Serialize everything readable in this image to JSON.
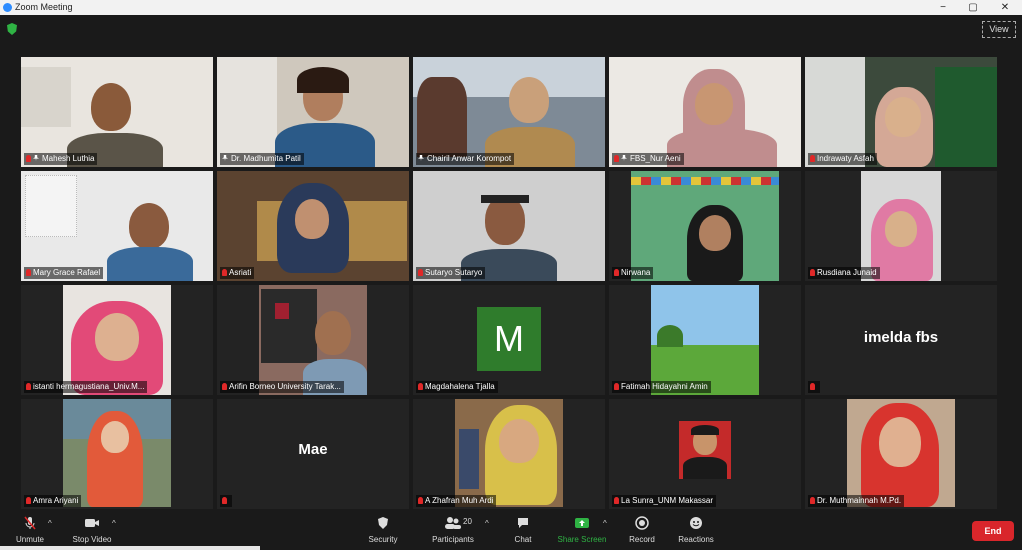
{
  "window": {
    "title": "Zoom Meeting",
    "minimize": "−",
    "maximize": "▢",
    "close": "✕"
  },
  "top": {
    "view_label": "View"
  },
  "participants": [
    {
      "name": "Mahesh Luthia",
      "pinned": true,
      "muted": true
    },
    {
      "name": "Dr. Madhumita Patil",
      "pinned": true,
      "muted": false,
      "active": true
    },
    {
      "name": "Chairil Anwar Korompot",
      "pinned": true,
      "muted": false
    },
    {
      "name": "FBS_Nur Aeni",
      "pinned": true,
      "muted": true
    },
    {
      "name": "Indrawaty Asfah",
      "pinned": false,
      "muted": true
    },
    {
      "name": "Mary Grace Rafael",
      "pinned": false,
      "muted": true
    },
    {
      "name": "Asriati",
      "pinned": false,
      "muted": true
    },
    {
      "name": "Sutaryo Sutaryo",
      "pinned": false,
      "muted": true
    },
    {
      "name": "Nirwana",
      "pinned": false,
      "muted": true
    },
    {
      "name": "Rusdiana Junaid",
      "pinned": false,
      "muted": true
    },
    {
      "name": "istanti hermagustiana_Univ.M...",
      "pinned": false,
      "muted": true
    },
    {
      "name": "Arifin Borneo University Tarak...",
      "pinned": false,
      "muted": true
    },
    {
      "name": "Magdahalena Tjalla",
      "pinned": false,
      "muted": true
    },
    {
      "name": "Fatimah Hidayahni Amin",
      "pinned": false,
      "muted": true
    },
    {
      "name": "",
      "pinned": false,
      "muted": true
    },
    {
      "name": "Amra Ariyani",
      "pinned": false,
      "muted": true
    },
    {
      "name": "",
      "pinned": false,
      "muted": true
    },
    {
      "name": "A Zhafran Muh Ardi",
      "pinned": false,
      "muted": true
    },
    {
      "name": "La Sunra_UNM Makassar",
      "pinned": false,
      "muted": true
    },
    {
      "name": "Dr. Muthmainnah M.Pd.",
      "pinned": false,
      "muted": true
    }
  ],
  "placeholders": {
    "magdahalena_initial": "M",
    "imelda_display": "imelda fbs",
    "mae_display": "Mae"
  },
  "toolbar": {
    "unmute": "Unmute",
    "stop_video": "Stop Video",
    "security": "Security",
    "participants": "Participants",
    "participants_count": "20",
    "chat": "Chat",
    "share_screen": "Share Screen",
    "record": "Record",
    "reactions": "Reactions",
    "end": "End"
  },
  "colors": {
    "background": "#1a1a1a",
    "end": "#d9262b",
    "share": "#2fb344",
    "active_speaker": "#c6e36b",
    "m_avatar": "#2f7c2c"
  }
}
